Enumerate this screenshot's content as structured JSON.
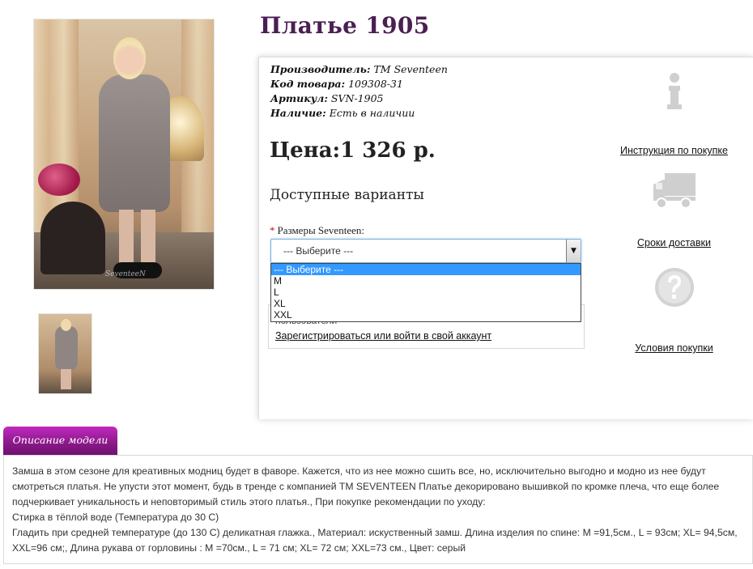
{
  "product": {
    "title": "Платье 1905",
    "manufacturer_label": "Производитель:",
    "manufacturer_value": "TM Seventeen",
    "code_label": "Код товара:",
    "code_value": "109308-31",
    "article_label": "Артикул:",
    "article_value": "SVN-1905",
    "availability_label": "Наличие:",
    "availability_value": "Есть в наличии",
    "price": "Цена:1 326 р.",
    "photo_watermark": "SeventeeN"
  },
  "variants": {
    "title": "Доступные варианты",
    "required_mark": "*",
    "size_label": "Размеры Seventeen:",
    "select_value": "--- Выберите ---",
    "options": [
      "--- Выберите ---",
      "M",
      "L",
      "XL",
      "XXL"
    ]
  },
  "register": {
    "note": "пользователи",
    "link": "Зарегистрироваться или войти в свой аккаунт"
  },
  "side_links": {
    "instruction": "Инструкция по покупке",
    "delivery": "Сроки доставки",
    "terms": "Условия покупки"
  },
  "icons": {
    "info": "info-icon",
    "delivery": "truck-icon",
    "terms": "question-icon"
  },
  "description": {
    "tab_label": "Описание модели",
    "lines": [
      "Замша в этом сезоне для креативных модниц будет в фаворе. Кажется, что из нее можно сшить все, но, исключительно выгодно и модно из нее будут",
      "смотреться платья. Не упусти этот момент, будь в тренде с компанией TM SEVENTEEN Платье декорировано вышивкой по кромке плеча, что еще более",
      "подчеркивает уникальность и неповторимый стиль этого платья., При покупке рекомендации по уходу:",
      "Стирка в тёплой воде (Температура до 30 С)",
      "Гладить при средней температуре (до 130 С) деликатная глажка., Материал: искуственный замш. Длина изделия по спине: M =91,5см., L = 93см; XL= 94,5см,",
      "XXL=96 см;, Длина рукава от горловины : M =70см., L = 71 см; XL= 72 см; XXL=73 см., Цвет: серый"
    ]
  },
  "colors": {
    "title": "#4a1f52",
    "tab": "#8a1888",
    "selected_option": "#3399ff"
  }
}
